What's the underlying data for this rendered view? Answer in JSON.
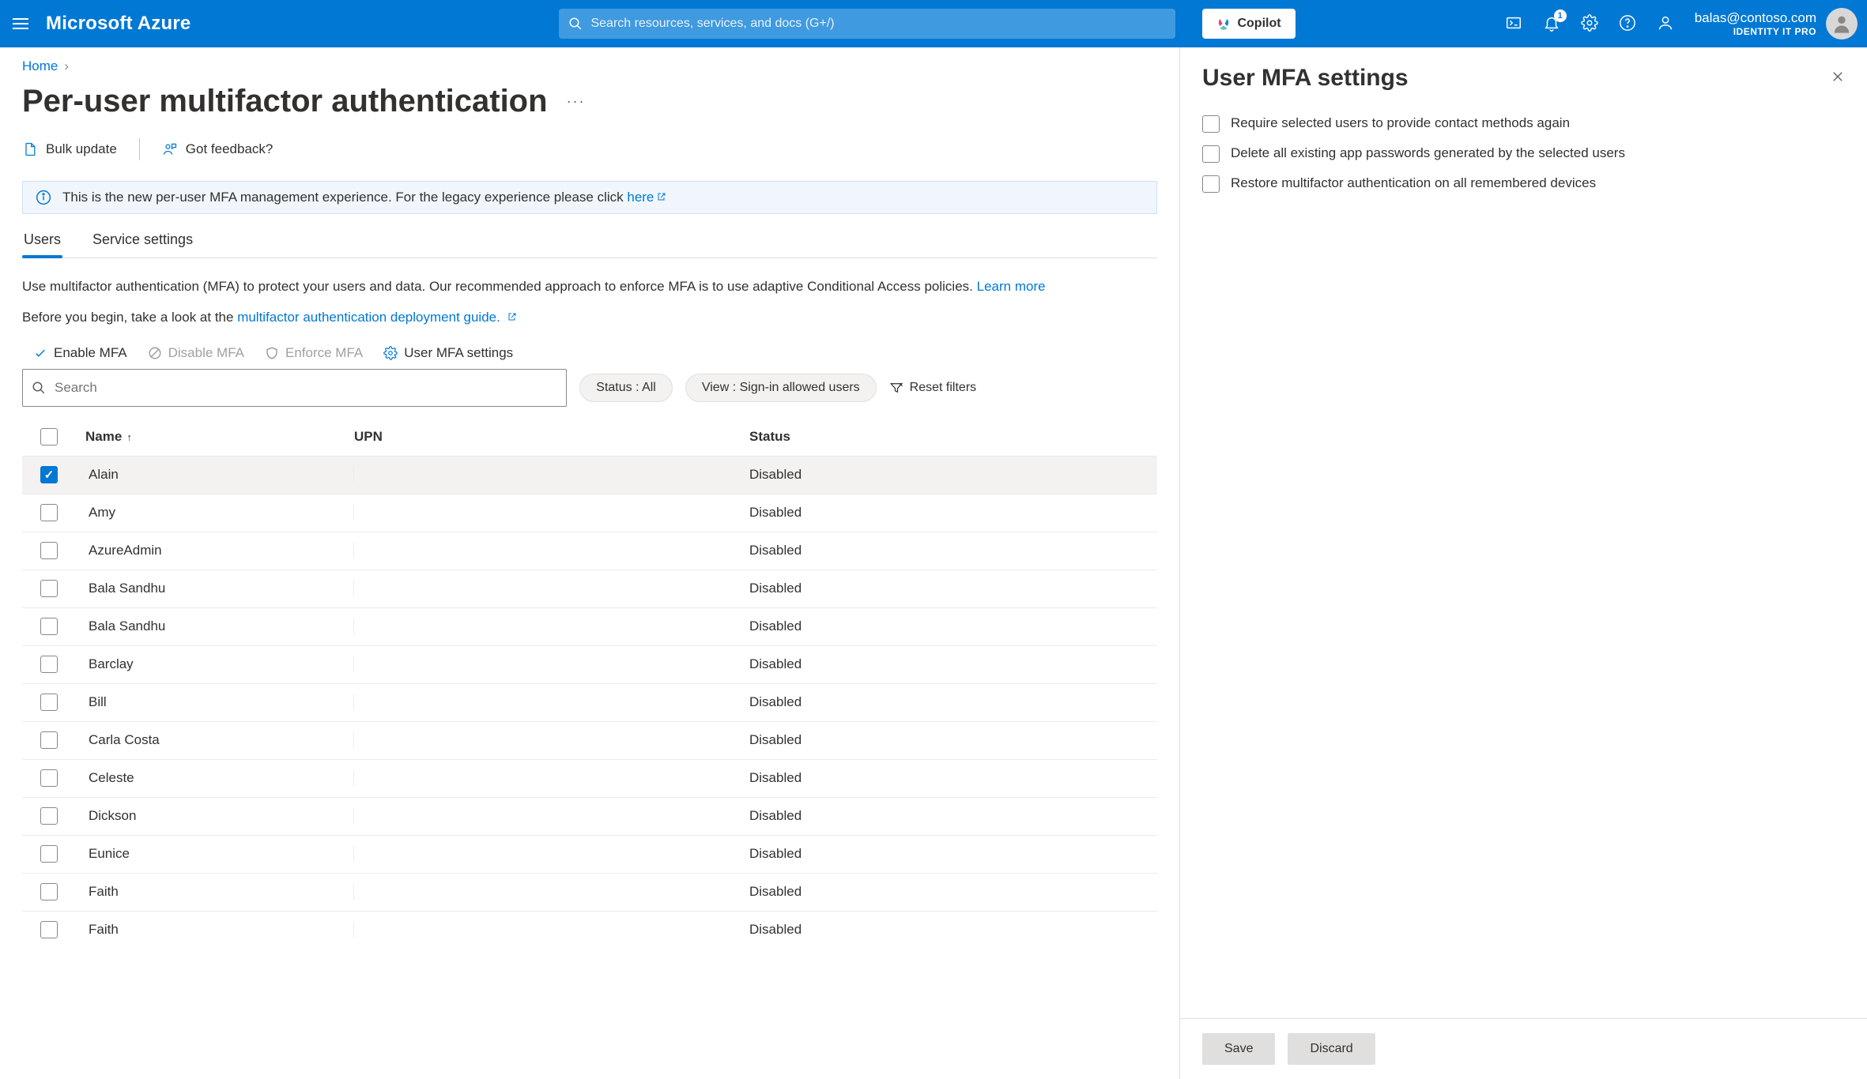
{
  "topbar": {
    "brand": "Microsoft Azure",
    "search_placeholder": "Search resources, services, and docs (G+/)",
    "copilot_label": "Copilot",
    "notification_badge": "1",
    "account_email": "balas@contoso.com",
    "account_role": "IDENTITY IT PRO"
  },
  "breadcrumb": {
    "home": "Home"
  },
  "page": {
    "title": "Per-user multifactor authentication"
  },
  "toolbar": {
    "bulk_update": "Bulk update",
    "got_feedback": "Got feedback?"
  },
  "infobar": {
    "text_before": "This is the new per-user MFA management experience. For the legacy experience please click ",
    "link": "here"
  },
  "tabs": {
    "users": "Users",
    "service_settings": "Service settings"
  },
  "body": {
    "line1_before": "Use multifactor authentication (MFA) to protect your users and data. Our recommended approach to enforce MFA is to use adaptive Conditional Access policies. ",
    "line1_link": "Learn more",
    "line2_before": "Before you begin, take a look at the ",
    "line2_link": "multifactor authentication deployment guide."
  },
  "actions": {
    "enable": "Enable MFA",
    "disable": "Disable MFA",
    "enforce": "Enforce MFA",
    "settings": "User MFA settings"
  },
  "filters": {
    "search_placeholder": "Search",
    "status_pill": "Status : All",
    "view_pill": "View : Sign-in allowed users",
    "reset": "Reset filters"
  },
  "table": {
    "headers": {
      "name": "Name",
      "upn": "UPN",
      "status": "Status"
    },
    "rows": [
      {
        "name": "Alain",
        "upn": "",
        "status": "Disabled",
        "selected": true
      },
      {
        "name": "Amy",
        "upn": "",
        "status": "Disabled",
        "selected": false
      },
      {
        "name": "AzureAdmin",
        "upn": "",
        "status": "Disabled",
        "selected": false
      },
      {
        "name": "Bala Sandhu",
        "upn": "",
        "status": "Disabled",
        "selected": false
      },
      {
        "name": "Bala Sandhu",
        "upn": "",
        "status": "Disabled",
        "selected": false
      },
      {
        "name": "Barclay",
        "upn": "",
        "status": "Disabled",
        "selected": false
      },
      {
        "name": "Bill",
        "upn": "",
        "status": "Disabled",
        "selected": false
      },
      {
        "name": "Carla Costa",
        "upn": "",
        "status": "Disabled",
        "selected": false
      },
      {
        "name": "Celeste",
        "upn": "",
        "status": "Disabled",
        "selected": false
      },
      {
        "name": "Dickson",
        "upn": "",
        "status": "Disabled",
        "selected": false
      },
      {
        "name": "Eunice",
        "upn": "",
        "status": "Disabled",
        "selected": false
      },
      {
        "name": "Faith",
        "upn": "",
        "status": "Disabled",
        "selected": false
      },
      {
        "name": "Faith",
        "upn": "",
        "status": "Disabled",
        "selected": false
      }
    ]
  },
  "panel": {
    "title": "User MFA settings",
    "opt1": "Require selected users to provide contact methods again",
    "opt2": "Delete all existing app passwords generated by the selected users",
    "opt3": "Restore multifactor authentication on all remembered devices",
    "save": "Save",
    "discard": "Discard"
  }
}
